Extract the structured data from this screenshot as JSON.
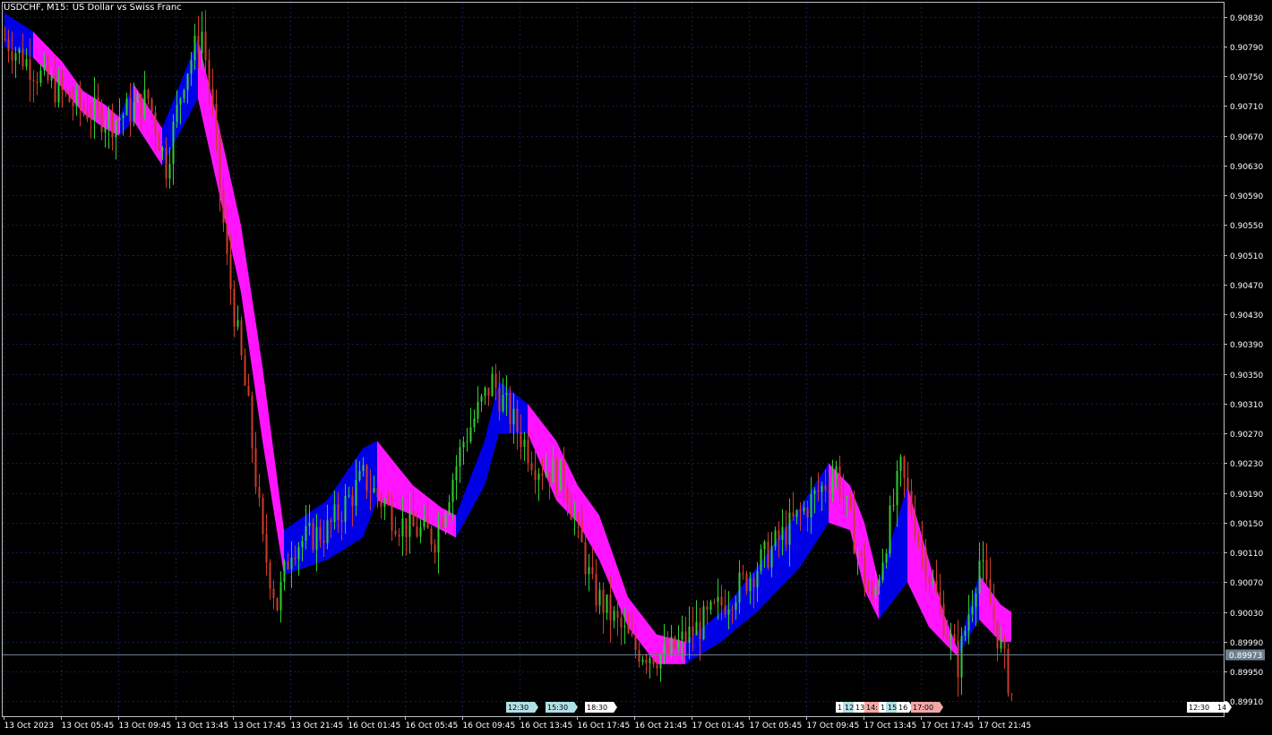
{
  "header": {
    "symbol_timeframe": "USDCHF, M15:",
    "description": "US Dollar vs Swiss Franc"
  },
  "colors": {
    "background": "#000000",
    "grid": "#1a1a4a",
    "axis": "#c0c0c0",
    "text": "#ffffff",
    "bull_candle": "#32cd32",
    "bear_candle": "#cd3c2a",
    "band_up": "#0000e6",
    "band_down": "#ff14ff",
    "bid_line": "#708090",
    "current_price_bg": "#708090"
  },
  "chart_data": {
    "type": "candlestick",
    "title": "",
    "xlabel": "",
    "ylabel": "",
    "ylim": [
      0.8989,
      0.9085
    ],
    "y_ticks": [
      "0.90830",
      "0.90790",
      "0.90750",
      "0.90710",
      "0.90670",
      "0.90630",
      "0.90590",
      "0.90550",
      "0.90510",
      "0.90470",
      "0.90430",
      "0.90390",
      "0.90350",
      "0.90310",
      "0.90270",
      "0.90230",
      "0.90190",
      "0.90150",
      "0.90110",
      "0.90070",
      "0.90030",
      "0.89990",
      "0.89950",
      "0.89910"
    ],
    "x_ticks": [
      "13 Oct 2023",
      "13 Oct 05:45",
      "13 Oct 09:45",
      "13 Oct 13:45",
      "13 Oct 17:45",
      "13 Oct 21:45",
      "16 Oct 01:45",
      "16 Oct 05:45",
      "16 Oct 09:45",
      "16 Oct 13:45",
      "16 Oct 17:45",
      "16 Oct 21:45",
      "17 Oct 01:45",
      "17 Oct 05:45",
      "17 Oct 09:45",
      "17 Oct 13:45",
      "17 Oct 17:45",
      "17 Oct 21:45"
    ],
    "current_price": "0.89973",
    "current_price_value": 0.89973,
    "bars_count": 282,
    "price_path": [
      [
        0,
        0.908
      ],
      [
        10,
        0.9075
      ],
      [
        20,
        0.9071
      ],
      [
        30,
        0.9069
      ],
      [
        40,
        0.9072
      ],
      [
        45,
        0.9063
      ],
      [
        50,
        0.9075
      ],
      [
        55,
        0.9081
      ],
      [
        58,
        0.907
      ],
      [
        62,
        0.905
      ],
      [
        65,
        0.904
      ],
      [
        68,
        0.903
      ],
      [
        72,
        0.9012
      ],
      [
        76,
        0.9004
      ],
      [
        80,
        0.9012
      ],
      [
        90,
        0.9014
      ],
      [
        100,
        0.9021
      ],
      [
        110,
        0.9015
      ],
      [
        120,
        0.9013
      ],
      [
        128,
        0.9026
      ],
      [
        136,
        0.9034
      ],
      [
        148,
        0.9023
      ],
      [
        156,
        0.9021
      ],
      [
        164,
        0.9006
      ],
      [
        176,
        0.8998
      ],
      [
        184,
        0.8997
      ],
      [
        196,
        0.9002
      ],
      [
        208,
        0.9008
      ],
      [
        220,
        0.9015
      ],
      [
        232,
        0.9022
      ],
      [
        242,
        0.9004
      ],
      [
        250,
        0.9022
      ],
      [
        258,
        0.9008
      ],
      [
        266,
        0.8996
      ],
      [
        272,
        0.901
      ],
      [
        276,
        0.9002
      ],
      [
        281,
        0.8992
      ]
    ],
    "band_segments": [
      {
        "trend": "up",
        "points": [
          [
            0,
            0.90835,
            0.9079
          ],
          [
            8,
            0.9081,
            0.90775
          ]
        ]
      },
      {
        "trend": "down",
        "points": [
          [
            8,
            0.9081,
            0.90775
          ],
          [
            16,
            0.9077,
            0.90735
          ],
          [
            22,
            0.9073,
            0.907
          ],
          [
            28,
            0.90712,
            0.9068
          ],
          [
            32,
            0.90695,
            0.9067
          ]
        ]
      },
      {
        "trend": "up",
        "points": [
          [
            32,
            0.90695,
            0.9067
          ],
          [
            36,
            0.9074,
            0.9069
          ]
        ]
      },
      {
        "trend": "down",
        "points": [
          [
            36,
            0.9074,
            0.9069
          ],
          [
            44,
            0.9068,
            0.9063
          ]
        ]
      },
      {
        "trend": "up",
        "points": [
          [
            44,
            0.9068,
            0.9063
          ],
          [
            54,
            0.908,
            0.9072
          ]
        ]
      },
      {
        "trend": "down",
        "points": [
          [
            54,
            0.908,
            0.9072
          ],
          [
            60,
            0.9068,
            0.9059
          ],
          [
            66,
            0.9055,
            0.9046
          ],
          [
            72,
            0.9036,
            0.9026
          ],
          [
            78,
            0.9014,
            0.9008
          ]
        ]
      },
      {
        "trend": "up",
        "points": [
          [
            78,
            0.9014,
            0.9008
          ],
          [
            90,
            0.9018,
            0.901
          ],
          [
            100,
            0.9025,
            0.9013
          ],
          [
            104,
            0.9026,
            0.9018
          ]
        ]
      },
      {
        "trend": "down",
        "points": [
          [
            104,
            0.9026,
            0.9018
          ],
          [
            114,
            0.902,
            0.9016
          ],
          [
            122,
            0.9017,
            0.9014
          ],
          [
            126,
            0.9016,
            0.9013
          ]
        ]
      },
      {
        "trend": "up",
        "points": [
          [
            126,
            0.9016,
            0.9013
          ],
          [
            134,
            0.9026,
            0.902
          ],
          [
            138,
            0.9034,
            0.9027
          ],
          [
            146,
            0.9031,
            0.9027
          ]
        ]
      },
      {
        "trend": "down",
        "points": [
          [
            146,
            0.9031,
            0.9027
          ],
          [
            154,
            0.9026,
            0.9018
          ],
          [
            160,
            0.902,
            0.9015
          ],
          [
            166,
            0.9016,
            0.901
          ],
          [
            174,
            0.9005,
            0.9001
          ],
          [
            182,
            0.9,
            0.8996
          ],
          [
            190,
            0.8999,
            0.8996
          ]
        ]
      },
      {
        "trend": "up",
        "points": [
          [
            190,
            0.8999,
            0.8996
          ],
          [
            200,
            0.9003,
            0.8999
          ],
          [
            210,
            0.9009,
            0.9003
          ],
          [
            222,
            0.9017,
            0.9009
          ],
          [
            230,
            0.9023,
            0.9015
          ]
        ]
      },
      {
        "trend": "down",
        "points": [
          [
            230,
            0.9023,
            0.9015
          ],
          [
            236,
            0.902,
            0.9014
          ],
          [
            240,
            0.9015,
            0.9006
          ],
          [
            244,
            0.9007,
            0.9002
          ]
        ]
      },
      {
        "trend": "up",
        "points": [
          [
            244,
            0.9007,
            0.9002
          ],
          [
            252,
            0.902,
            0.9007
          ]
        ]
      },
      {
        "trend": "down",
        "points": [
          [
            252,
            0.902,
            0.9007
          ],
          [
            258,
            0.901,
            0.9001
          ],
          [
            262,
            0.9003,
            0.8999
          ],
          [
            266,
            0.8998,
            0.8997
          ]
        ]
      },
      {
        "trend": "up",
        "points": [
          [
            266,
            0.8998,
            0.8997
          ],
          [
            272,
            0.9008,
            0.9002
          ]
        ]
      },
      {
        "trend": "down",
        "points": [
          [
            272,
            0.9008,
            0.9002
          ],
          [
            278,
            0.9004,
            0.8999
          ],
          [
            281,
            0.9003,
            0.8999
          ]
        ]
      }
    ],
    "session_markers": [
      {
        "label": "12:30",
        "color": "#b0e0e6",
        "bar": 140
      },
      {
        "label": "15:30",
        "color": "#b0e0e6",
        "bar": 151
      },
      {
        "label": "18:30",
        "color": "#ffffff",
        "bar": 162
      },
      {
        "label": "1",
        "color": "#ffffff",
        "bar": 232
      },
      {
        "label": "12",
        "color": "#b0e0e6",
        "bar": 234
      },
      {
        "label": "13",
        "color": "#ffffff",
        "bar": 237
      },
      {
        "label": "14:",
        "color": "#f4a6a6",
        "bar": 240
      },
      {
        "label": "1",
        "color": "#ffffff",
        "bar": 244
      },
      {
        "label": "15",
        "color": "#b0e0e6",
        "bar": 246
      },
      {
        "label": "16",
        "color": "#ffffff",
        "bar": 249
      },
      {
        "label": "17:00",
        "color": "#f4a6a6",
        "bar": 253
      },
      {
        "label": "12:30",
        "color": "#ffffff",
        "bar": 330
      },
      {
        "label": "14",
        "color": "#ffffff",
        "bar": 338
      }
    ]
  }
}
